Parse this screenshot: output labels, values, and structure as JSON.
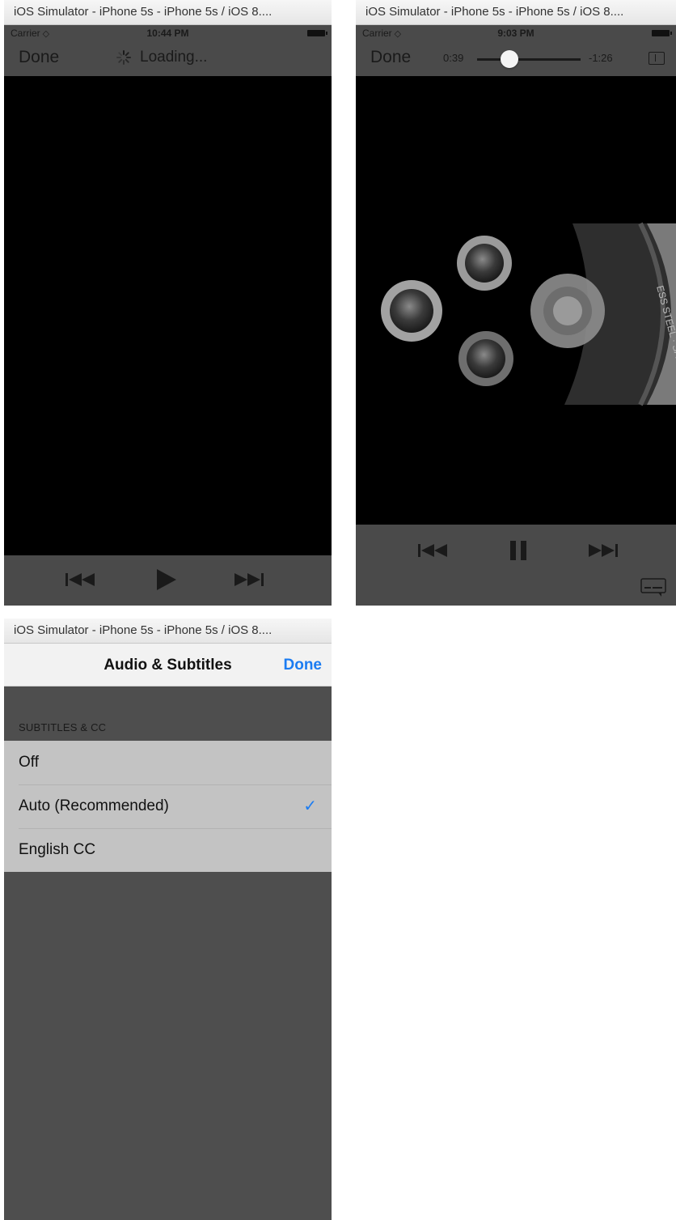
{
  "simulator_title": "iOS Simulator - iPhone 5s - iPhone 5s / iOS 8....",
  "screen1": {
    "status": {
      "carrier": "Carrier",
      "time": "10:44 PM"
    },
    "done_label": "Done",
    "loading_label": "Loading..."
  },
  "screen2": {
    "status": {
      "carrier": "Carrier",
      "time": "9:03 PM"
    },
    "done_label": "Done",
    "elapsed": "0:39",
    "remaining": "-1:26",
    "playback_progress": 0.31
  },
  "screen3": {
    "title": "Audio & Subtitles",
    "done_label": "Done",
    "section_header": "SUBTITLES & CC",
    "options": [
      {
        "label": "Off"
      },
      {
        "label": "Auto (Recommended)"
      },
      {
        "label": "English CC"
      }
    ],
    "selected_option": "Auto (Recommended)"
  },
  "colors": {
    "accent": "#1b7cf2",
    "bar": "#4a4a4a",
    "video": "#000000",
    "list": "#c3c3c3"
  },
  "icons": [
    "wifi-icon",
    "spinner-icon",
    "previous-track-icon",
    "play-icon",
    "pause-icon",
    "next-track-icon",
    "aspect-ratio-icon",
    "subtitles-icon",
    "checkmark-icon"
  ]
}
